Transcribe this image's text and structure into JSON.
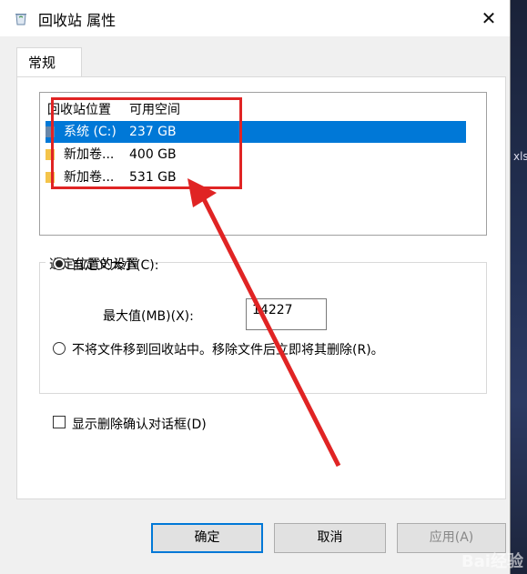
{
  "window": {
    "title": "回收站 属性",
    "close_glyph": "✕"
  },
  "tabs": [
    {
      "label": "常规"
    }
  ],
  "list": {
    "headers": [
      "回收站位置",
      "可用空间"
    ],
    "rows": [
      {
        "name": "系统 (C:)",
        "space": "237 GB",
        "icon": "drive-icon",
        "selected": true
      },
      {
        "name": "新加卷...",
        "space": "400 GB",
        "icon": "folder-icon",
        "selected": false
      },
      {
        "name": "新加卷...",
        "space": "531 GB",
        "icon": "folder-icon",
        "selected": false
      }
    ]
  },
  "settings": {
    "group_title": "选定位置的设置",
    "custom_size_label": "自定义大小(C):",
    "custom_size_selected": true,
    "max_label": "最大值(MB)(X):",
    "max_value": "14227",
    "delete_immediately_label": "不将文件移到回收站中。移除文件后立即将其删除(R)。",
    "delete_immediately_selected": false
  },
  "confirm_checkbox": {
    "label": "显示删除确认对话框(D)",
    "checked": false
  },
  "buttons": {
    "ok": "确定",
    "cancel": "取消",
    "apply": "应用(A)"
  },
  "watermark": "Bai经验",
  "colors": {
    "selection": "#0078d7",
    "annotation": "#e02424",
    "dialog_bg": "#f0f0f0"
  }
}
